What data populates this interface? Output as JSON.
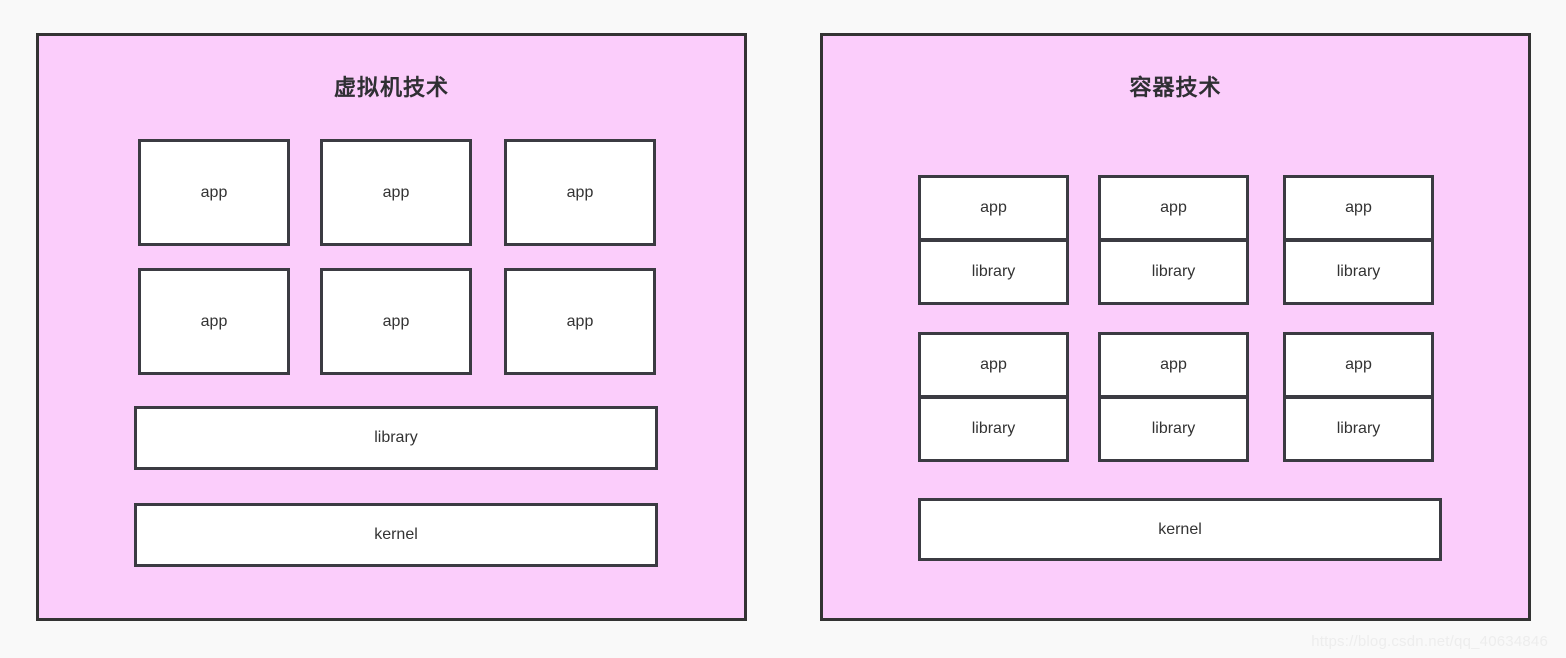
{
  "page": {
    "background_color": "#f9f9f9",
    "watermark": "https://blog.csdn.net/qq_40634846"
  },
  "colors": {
    "panel_fill": "#fbcdfb",
    "panel_border": "#333333",
    "box_fill": "#ffffff",
    "box_border": "#3b3b42",
    "text": "#333333",
    "title_text": "#2f2f33"
  },
  "panels": [
    {
      "id": "virtual-machine",
      "title": "虚拟机技术",
      "apps": [
        {
          "label": "app"
        },
        {
          "label": "app"
        },
        {
          "label": "app"
        },
        {
          "label": "app"
        },
        {
          "label": "app"
        },
        {
          "label": "app"
        }
      ],
      "library": {
        "label": "library"
      },
      "kernel": {
        "label": "kernel"
      }
    },
    {
      "id": "container",
      "title": "容器技术",
      "containers": [
        {
          "app": "app",
          "library": "library"
        },
        {
          "app": "app",
          "library": "library"
        },
        {
          "app": "app",
          "library": "library"
        },
        {
          "app": "app",
          "library": "library"
        },
        {
          "app": "app",
          "library": "library"
        },
        {
          "app": "app",
          "library": "library"
        }
      ],
      "kernel": {
        "label": "kernel"
      }
    }
  ]
}
